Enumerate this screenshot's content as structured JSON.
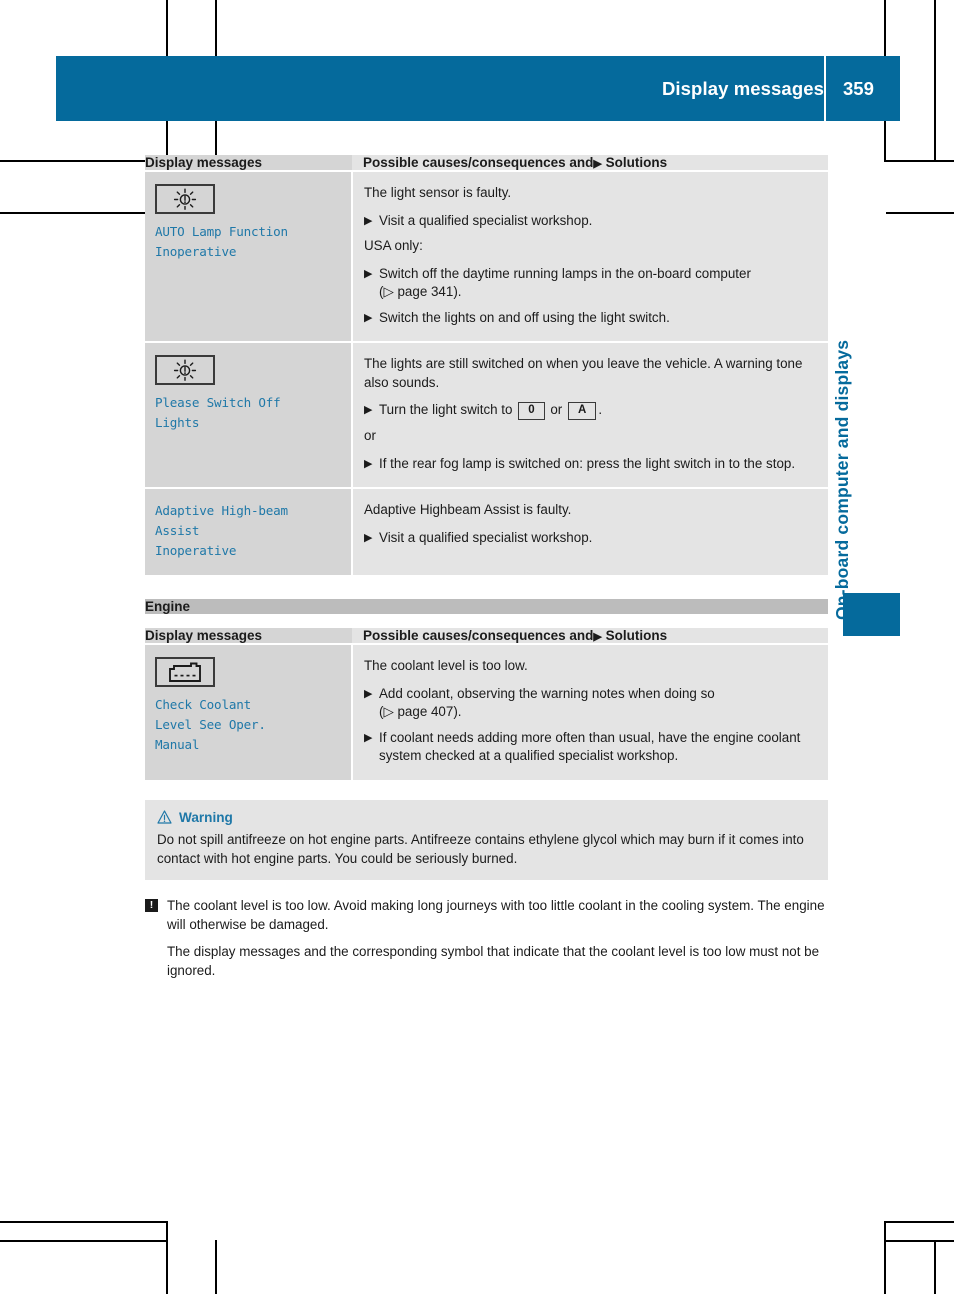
{
  "page": {
    "header_title": "Display messages",
    "page_number": "359",
    "chapter_tab": "On-board computer and displays",
    "accent_color": "#056a9c",
    "message_text_color": "#1f78a8"
  },
  "tables": [
    {
      "section_title": null,
      "columns": {
        "c1": "Display messages",
        "c2_prefix": "Possible causes/consequences and",
        "c2_marker": "▶",
        "c2_suffix": "Solutions"
      },
      "rows": [
        {
          "icon": "lamp-bulb-icon",
          "message": "AUTO Lamp Function\nInoperative",
          "blocks": [
            {
              "kind": "para",
              "text": "The light sensor is faulty."
            },
            {
              "kind": "bullet",
              "text": "Visit a qualified specialist workshop."
            },
            {
              "kind": "para",
              "text": "USA only:"
            },
            {
              "kind": "bullet",
              "text": "Switch off the daytime running lamps in the on-board computer",
              "ref": "(▷ page 341)."
            },
            {
              "kind": "bullet",
              "text": "Switch the lights on and off using the light switch."
            }
          ]
        },
        {
          "icon": "lamp-bulb-icon",
          "message": "Please Switch Off\nLights",
          "blocks": [
            {
              "kind": "para",
              "text": "The lights are still switched on when you leave the vehicle. A warning tone also sounds."
            },
            {
              "kind": "bullet-keys",
              "pre": "Turn the light switch to",
              "key1": "0",
              "mid": "or",
              "key2": "A",
              "post": "."
            },
            {
              "kind": "para-plain",
              "text": "or"
            },
            {
              "kind": "bullet",
              "text": "If the rear fog lamp is switched on: press the light switch in to the stop."
            }
          ]
        },
        {
          "icon": null,
          "message": "Adaptive High-beam\nAssist\nInoperative",
          "blocks": [
            {
              "kind": "para",
              "text": "Adaptive Highbeam Assist is faulty."
            },
            {
              "kind": "bullet",
              "text": "Visit a qualified specialist workshop."
            }
          ]
        }
      ]
    },
    {
      "section_title": "Engine",
      "columns": {
        "c1": "Display messages",
        "c2_prefix": "Possible causes/consequences and",
        "c2_marker": "▶",
        "c2_suffix": "Solutions"
      },
      "rows": [
        {
          "icon": "coolant-reservoir-icon",
          "message": "Check Coolant\nLevel See Oper.\nManual",
          "blocks": [
            {
              "kind": "para",
              "text": "The coolant level is too low."
            },
            {
              "kind": "bullet",
              "text": "Add coolant, observing the warning notes when doing so",
              "ref": "(▷ page 407)."
            },
            {
              "kind": "bullet",
              "text": "If coolant needs adding more often than usual, have the engine coolant system checked at a qualified specialist workshop."
            }
          ]
        }
      ]
    }
  ],
  "warning": {
    "icon": "warning-triangle-icon",
    "title": "Warning",
    "body": "Do not spill antifreeze on hot engine parts. Antifreeze contains ethylene glycol which may burn if it comes into contact with hot engine parts. You could be seriously burned."
  },
  "notes": {
    "icon": "exclamation-box-icon",
    "icon_glyph": "!",
    "primary": "The coolant level is too low. Avoid making long journeys with too little coolant in the cooling system. The engine will otherwise be damaged.",
    "secondary": "The display messages and the corresponding symbol that indicate that the coolant level is too low must not be ignored."
  }
}
